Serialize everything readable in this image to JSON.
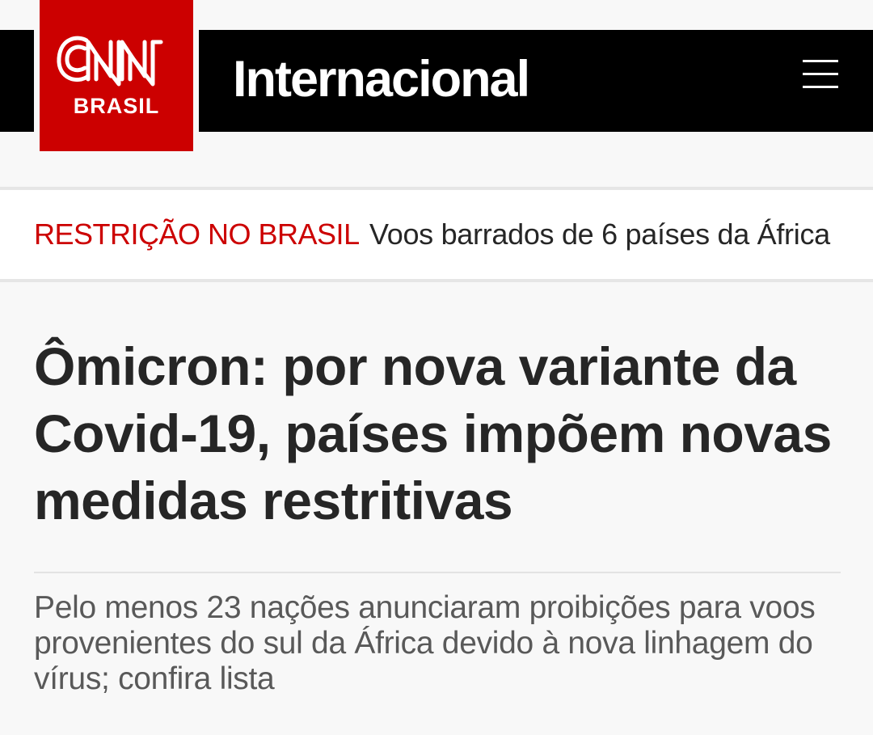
{
  "header": {
    "logo": {
      "primary": "CNN",
      "secondary": "BRASIL"
    },
    "section_title": "Internacional",
    "menu_icon": "hamburger-menu-icon",
    "colors": {
      "bar": "#000000",
      "logo": "#cc0000"
    }
  },
  "breaking": {
    "tag": "RESTRIÇÃO NO BRASIL",
    "text": "Voos barrados de 6 países da África",
    "tag_color": "#cc0000"
  },
  "article": {
    "headline": "Ômicron: por nova variante da Covid-19, países impõem novas medidas restritivas",
    "summary": "Pelo menos 23 nações anunciaram proibições para voos provenientes do sul da África devido à nova linhagem do vírus; confira lista"
  }
}
